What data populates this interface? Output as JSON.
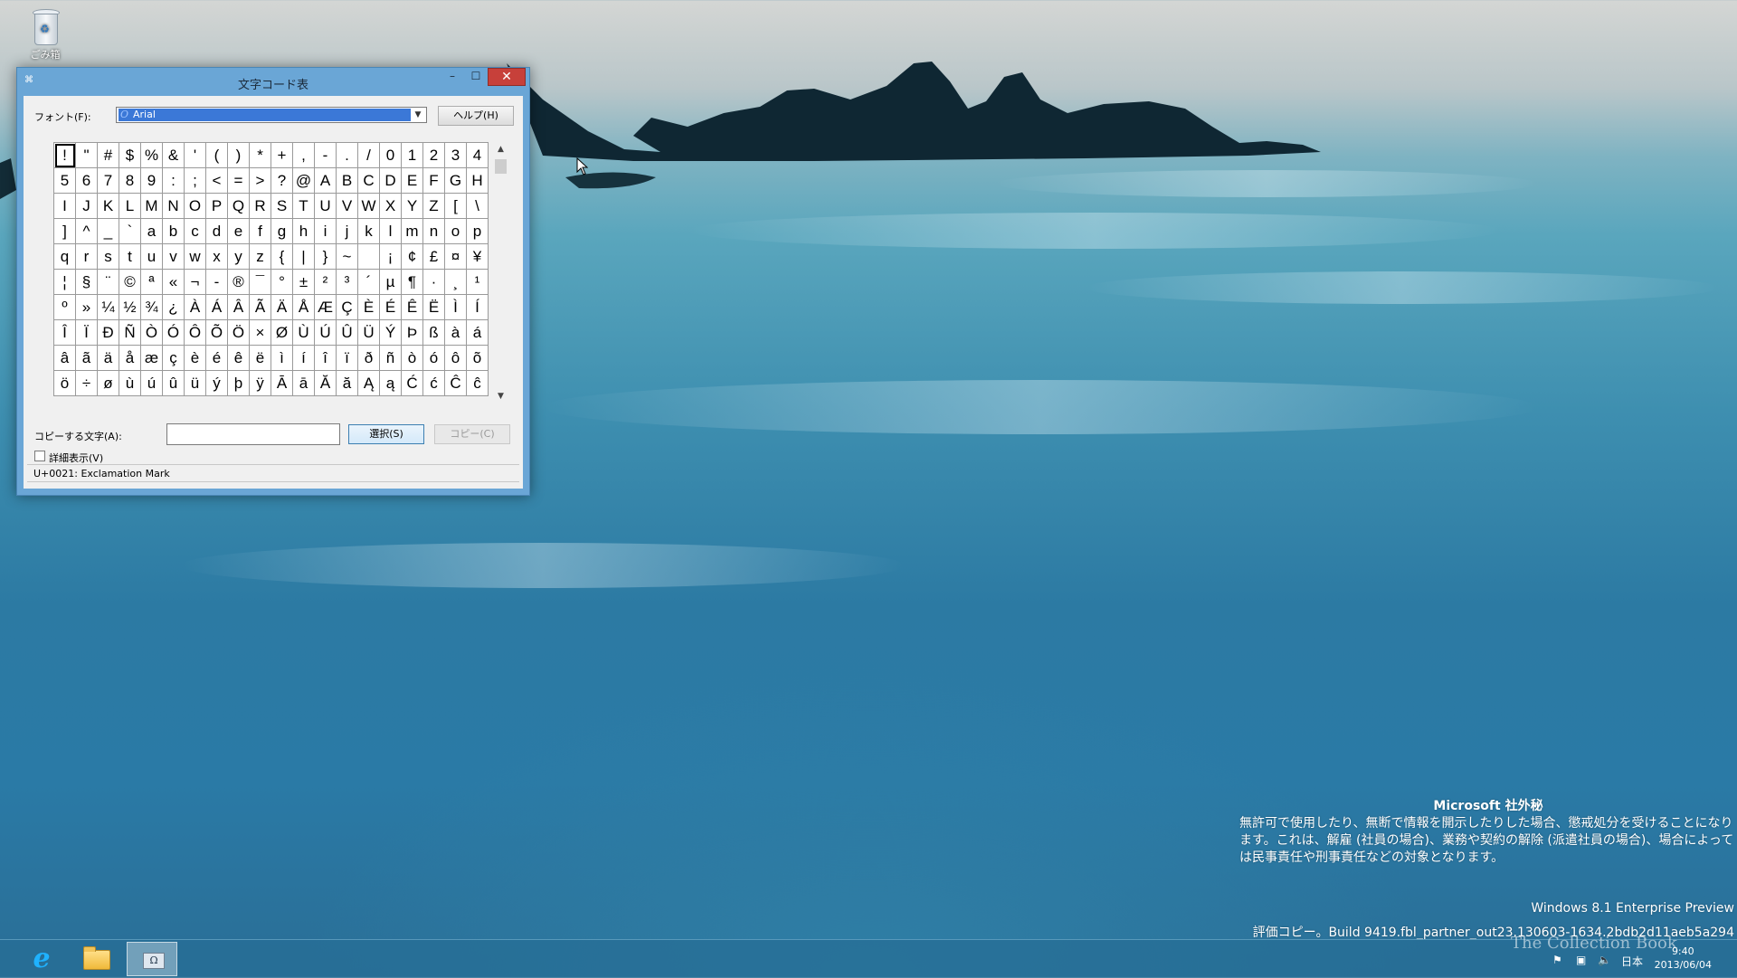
{
  "desktop": {
    "recycle_bin_label": "ごみ箱"
  },
  "window": {
    "title": "文字コード表",
    "minimize": "–",
    "maximize": "☐",
    "close": "✕",
    "font_label": "フォント(F):",
    "font_value": "Arial",
    "help_button": "ヘルプ(H)",
    "copy_label": "コピーする文字(A):",
    "copy_value": "",
    "select_button": "選択(S)",
    "copy_button": "コピー(C)",
    "advanced_label": "詳細表示(V)",
    "status": "U+0021: Exclamation Mark",
    "grid": [
      [
        "!",
        "\"",
        "#",
        "$",
        "%",
        "&",
        "'",
        "(",
        ")",
        "*",
        "+",
        ",",
        "-",
        ".",
        "/",
        "0",
        "1",
        "2",
        "3",
        "4"
      ],
      [
        "5",
        "6",
        "7",
        "8",
        "9",
        ":",
        ";",
        "<",
        "=",
        ">",
        "?",
        "@",
        "A",
        "B",
        "C",
        "D",
        "E",
        "F",
        "G",
        "H"
      ],
      [
        "I",
        "J",
        "K",
        "L",
        "M",
        "N",
        "O",
        "P",
        "Q",
        "R",
        "S",
        "T",
        "U",
        "V",
        "W",
        "X",
        "Y",
        "Z",
        "[",
        "\\"
      ],
      [
        "]",
        "^",
        "_",
        "`",
        "a",
        "b",
        "c",
        "d",
        "e",
        "f",
        "g",
        "h",
        "i",
        "j",
        "k",
        "l",
        "m",
        "n",
        "o",
        "p"
      ],
      [
        "q",
        "r",
        "s",
        "t",
        "u",
        "v",
        "w",
        "x",
        "y",
        "z",
        "{",
        "|",
        "}",
        "~",
        "",
        "¡",
        "¢",
        "£",
        "¤",
        "¥"
      ],
      [
        "¦",
        "§",
        "¨",
        "©",
        "ª",
        "«",
        "¬",
        "-",
        "®",
        "¯",
        "°",
        "±",
        "²",
        "³",
        "´",
        "µ",
        "¶",
        "·",
        "¸",
        "¹"
      ],
      [
        "º",
        "»",
        "¼",
        "½",
        "¾",
        "¿",
        "À",
        "Á",
        "Â",
        "Ã",
        "Ä",
        "Å",
        "Æ",
        "Ç",
        "È",
        "É",
        "Ê",
        "Ë",
        "Ì",
        "Í"
      ],
      [
        "Î",
        "Ï",
        "Ð",
        "Ñ",
        "Ò",
        "Ó",
        "Ô",
        "Õ",
        "Ö",
        "×",
        "Ø",
        "Ù",
        "Ú",
        "Û",
        "Ü",
        "Ý",
        "Þ",
        "ß",
        "à",
        "á"
      ],
      [
        "â",
        "ã",
        "ä",
        "å",
        "æ",
        "ç",
        "è",
        "é",
        "ê",
        "ë",
        "ì",
        "í",
        "î",
        "ï",
        "ð",
        "ñ",
        "ò",
        "ó",
        "ô",
        "õ"
      ],
      [
        "ö",
        "÷",
        "ø",
        "ù",
        "ú",
        "û",
        "ü",
        "ý",
        "þ",
        "ÿ",
        "Ā",
        "ā",
        "Ă",
        "ă",
        "Ą",
        "ą",
        "Ć",
        "ć",
        "Ĉ",
        "ĉ"
      ]
    ]
  },
  "watermark": {
    "confidential_head": "Microsoft 社外秘",
    "confidential_body": "無許可で使用したり、無断で情報を開示したりした場合、懲戒処分を受けることになります。これは、解雇 (社員の場合)、業務や契約の解除 (派遣社員の場合)、場合によっては民事責任や刑事責任などの対象となります。",
    "edition": "Windows 8.1 Enterprise Preview",
    "build": "評価コピー。Build 9419.fbl_partner_out23.130603-1634.2bdb2d11aeb5a294"
  },
  "taskbar": {
    "language": "日本",
    "time": "9:40",
    "date": "2013/06/04",
    "overlay_text": "The Collection Book"
  },
  "colors": {
    "close_red": "#c7403a",
    "selection_blue": "#3b78d7",
    "window_frame": "#6aa6d6"
  }
}
